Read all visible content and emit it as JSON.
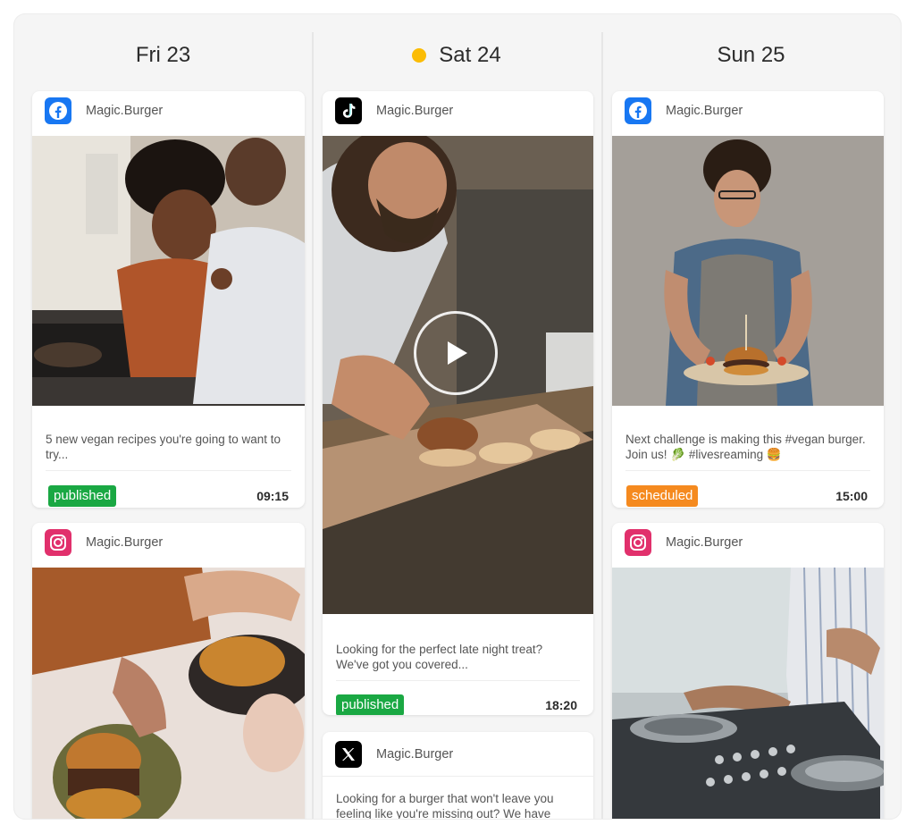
{
  "days": [
    {
      "label": "Fri 23",
      "is_today": false
    },
    {
      "label": "Sat 24",
      "is_today": true
    },
    {
      "label": "Sun 25",
      "is_today": false
    }
  ],
  "colors": {
    "published": "#1aa843",
    "scheduled": "#f58a1f",
    "today_dot": "#fbbc05",
    "facebook": "#1877f2",
    "instagram": "#e1306c",
    "tiktok": "#000000",
    "x": "#000000"
  },
  "posts": {
    "fri_1": {
      "network_icon": "facebook-icon",
      "account": "Magic.Burger",
      "caption": "5 new vegan recipes you're going to want to try...",
      "status": "published",
      "time": "09:15"
    },
    "fri_2": {
      "network_icon": "instagram-icon",
      "account": "Magic.Burger"
    },
    "sat_1": {
      "network_icon": "tiktok-icon",
      "account": "Magic.Burger",
      "caption": "Looking for the perfect late night treat? We've got you covered...",
      "status": "published",
      "time": "18:20",
      "media": "video-play-icon"
    },
    "sat_2": {
      "network_icon": "x-icon",
      "account": "Magic.Burger",
      "caption": "Looking for a burger that won't leave you feeling like you're missing out? We have"
    },
    "sun_1": {
      "network_icon": "facebook-icon",
      "account": "Magic.Burger",
      "caption": "Next challenge is making this #vegan burger. Join us! 🥬 #livesreaming 🍔",
      "status": "scheduled",
      "time": "15:00"
    },
    "sun_2": {
      "network_icon": "instagram-icon",
      "account": "Magic.Burger"
    }
  }
}
